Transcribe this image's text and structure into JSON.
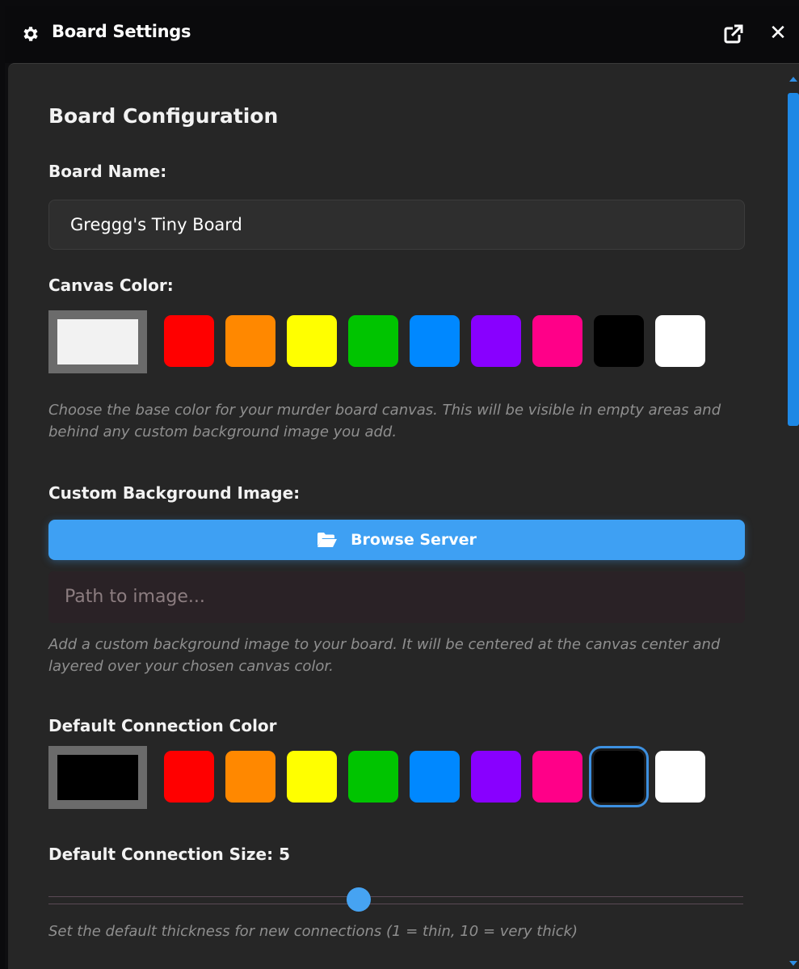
{
  "window": {
    "title": "Board Settings",
    "icons": {
      "title": "gear-icon",
      "popout": "external-link-icon",
      "close": "close-icon"
    },
    "close_glyph": "✕"
  },
  "section": {
    "heading": "Board Configuration"
  },
  "board_name": {
    "label": "Board Name:",
    "value": "Greggg's Tiny Board"
  },
  "canvas_color": {
    "label": "Canvas Color:",
    "current": "#f2f2f2",
    "swatches": [
      "#ff0000",
      "#ff8800",
      "#ffff00",
      "#00c400",
      "#0088ff",
      "#8800ff",
      "#ff0088",
      "#000000",
      "#ffffff"
    ],
    "hint": "Choose the base color for your murder board canvas. This will be visible in empty areas and behind any custom background image you add."
  },
  "background_image": {
    "label": "Custom Background Image:",
    "browse_label": "Browse Server",
    "browse_icon": "folder-open-icon",
    "path_placeholder": "Path to image...",
    "hint": "Add a custom background image to your board. It will be centered at the canvas center and layered over your chosen canvas color."
  },
  "connection_color": {
    "label": "Default Connection Color",
    "current": "#000000",
    "selected_index": 7,
    "swatches": [
      "#ff0000",
      "#ff8800",
      "#ffff00",
      "#00c400",
      "#0088ff",
      "#8800ff",
      "#ff0088",
      "#000000",
      "#ffffff"
    ]
  },
  "connection_size": {
    "label": "Default Connection Size: 5",
    "value": 5,
    "min": 1,
    "max": 10,
    "hint": "Set the default thickness for new connections (1 = thin, 10 = very thick)"
  },
  "colors": {
    "accent": "#3ea0f3",
    "panel_bg": "#262626",
    "title_bg": "#0a0a0c"
  }
}
